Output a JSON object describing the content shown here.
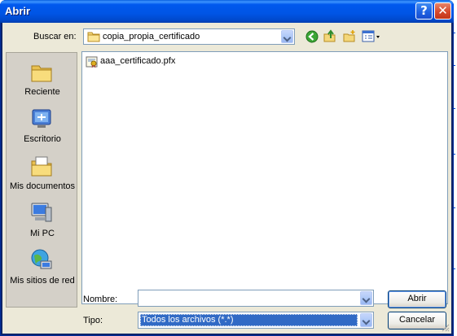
{
  "window": {
    "title": "Abrir",
    "help_glyph": "?",
    "close_glyph": "✕"
  },
  "toolbar": {
    "look_in_label": "Buscar en:",
    "look_in_value": "copia_propia_certificado",
    "icons": [
      "back-icon",
      "up-folder-icon",
      "new-folder-icon",
      "views-menu-icon"
    ]
  },
  "places": [
    {
      "label": "Reciente",
      "icon": "recent-icon"
    },
    {
      "label": "Escritorio",
      "icon": "desktop-icon"
    },
    {
      "label": "Mis documentos",
      "icon": "my-documents-icon"
    },
    {
      "label": "Mi PC",
      "icon": "my-computer-icon"
    },
    {
      "label": "Mis sitios de red",
      "icon": "network-places-icon"
    }
  ],
  "files": [
    {
      "name": "aaa_certificado.pfx",
      "icon": "certificate-file-icon"
    }
  ],
  "footer": {
    "name_label": "Nombre:",
    "name_value": "",
    "type_label": "Tipo:",
    "type_value": "Todos los archivos (*.*)",
    "open_label": "Abrir",
    "cancel_label": "Cancelar"
  },
  "colors": {
    "title_bar": "#0055e5",
    "dialog_face": "#ece9d8",
    "selection": "#316ac5"
  }
}
